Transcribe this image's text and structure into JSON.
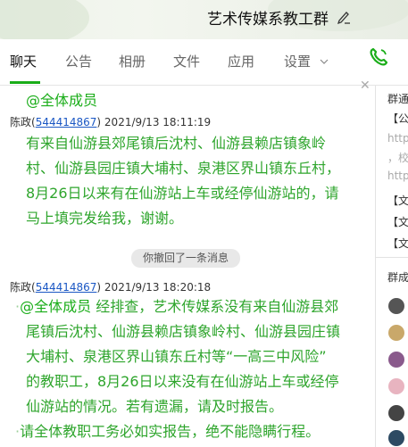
{
  "header": {
    "title": "艺术传媒系教工群"
  },
  "tabs": [
    {
      "label": "聊天"
    },
    {
      "label": "公告"
    },
    {
      "label": "相册"
    },
    {
      "label": "文件"
    },
    {
      "label": "应用"
    },
    {
      "label": "设置"
    }
  ],
  "chat": {
    "msg1": {
      "mention": "@全体成员",
      "sender": "陈政",
      "qq": "544414867",
      "time": "2021/9/13 18:11:19",
      "lines": [
        "有来自仙游县郊尾镇后沈村、仙游县赖店镇象岭",
        "村、仙游县园庄镇大埔村、泉港区界山镇东丘村，",
        "8月26日以来有在仙游站上车或经停仙游站的，请",
        "马上填完发给我，谢谢。"
      ]
    },
    "recall_notice": "你撤回了一条消息",
    "msg2": {
      "sender": "陈政",
      "qq": "544414867",
      "time": "2021/9/13 18:20:18",
      "mention": "@全体成员",
      "line1_rest": " 经排查，艺术传媒系没有来自仙游县郊",
      "lines": [
        "尾镇后沈村、仙游县赖店镇象岭村、仙游县园庄镇",
        "大埔村、泉港区界山镇东丘村等“一高三中风险”",
        "的教职工，8月26日以来没有在仙游站上车或经停",
        "仙游站的情况。若有遗漏，请及时报告。"
      ],
      "last": "请全体教职工务必如实报告，绝不能隐瞒行程。"
    }
  },
  "right_panel": {
    "notice_head": "群通",
    "notice_tag": "【公告",
    "link1": "https:",
    "note1": "，校",
    "link2": "https:",
    "doc1": "【文件",
    "doc2": "【文件",
    "doc3": "【文件",
    "members_head": "群成"
  }
}
